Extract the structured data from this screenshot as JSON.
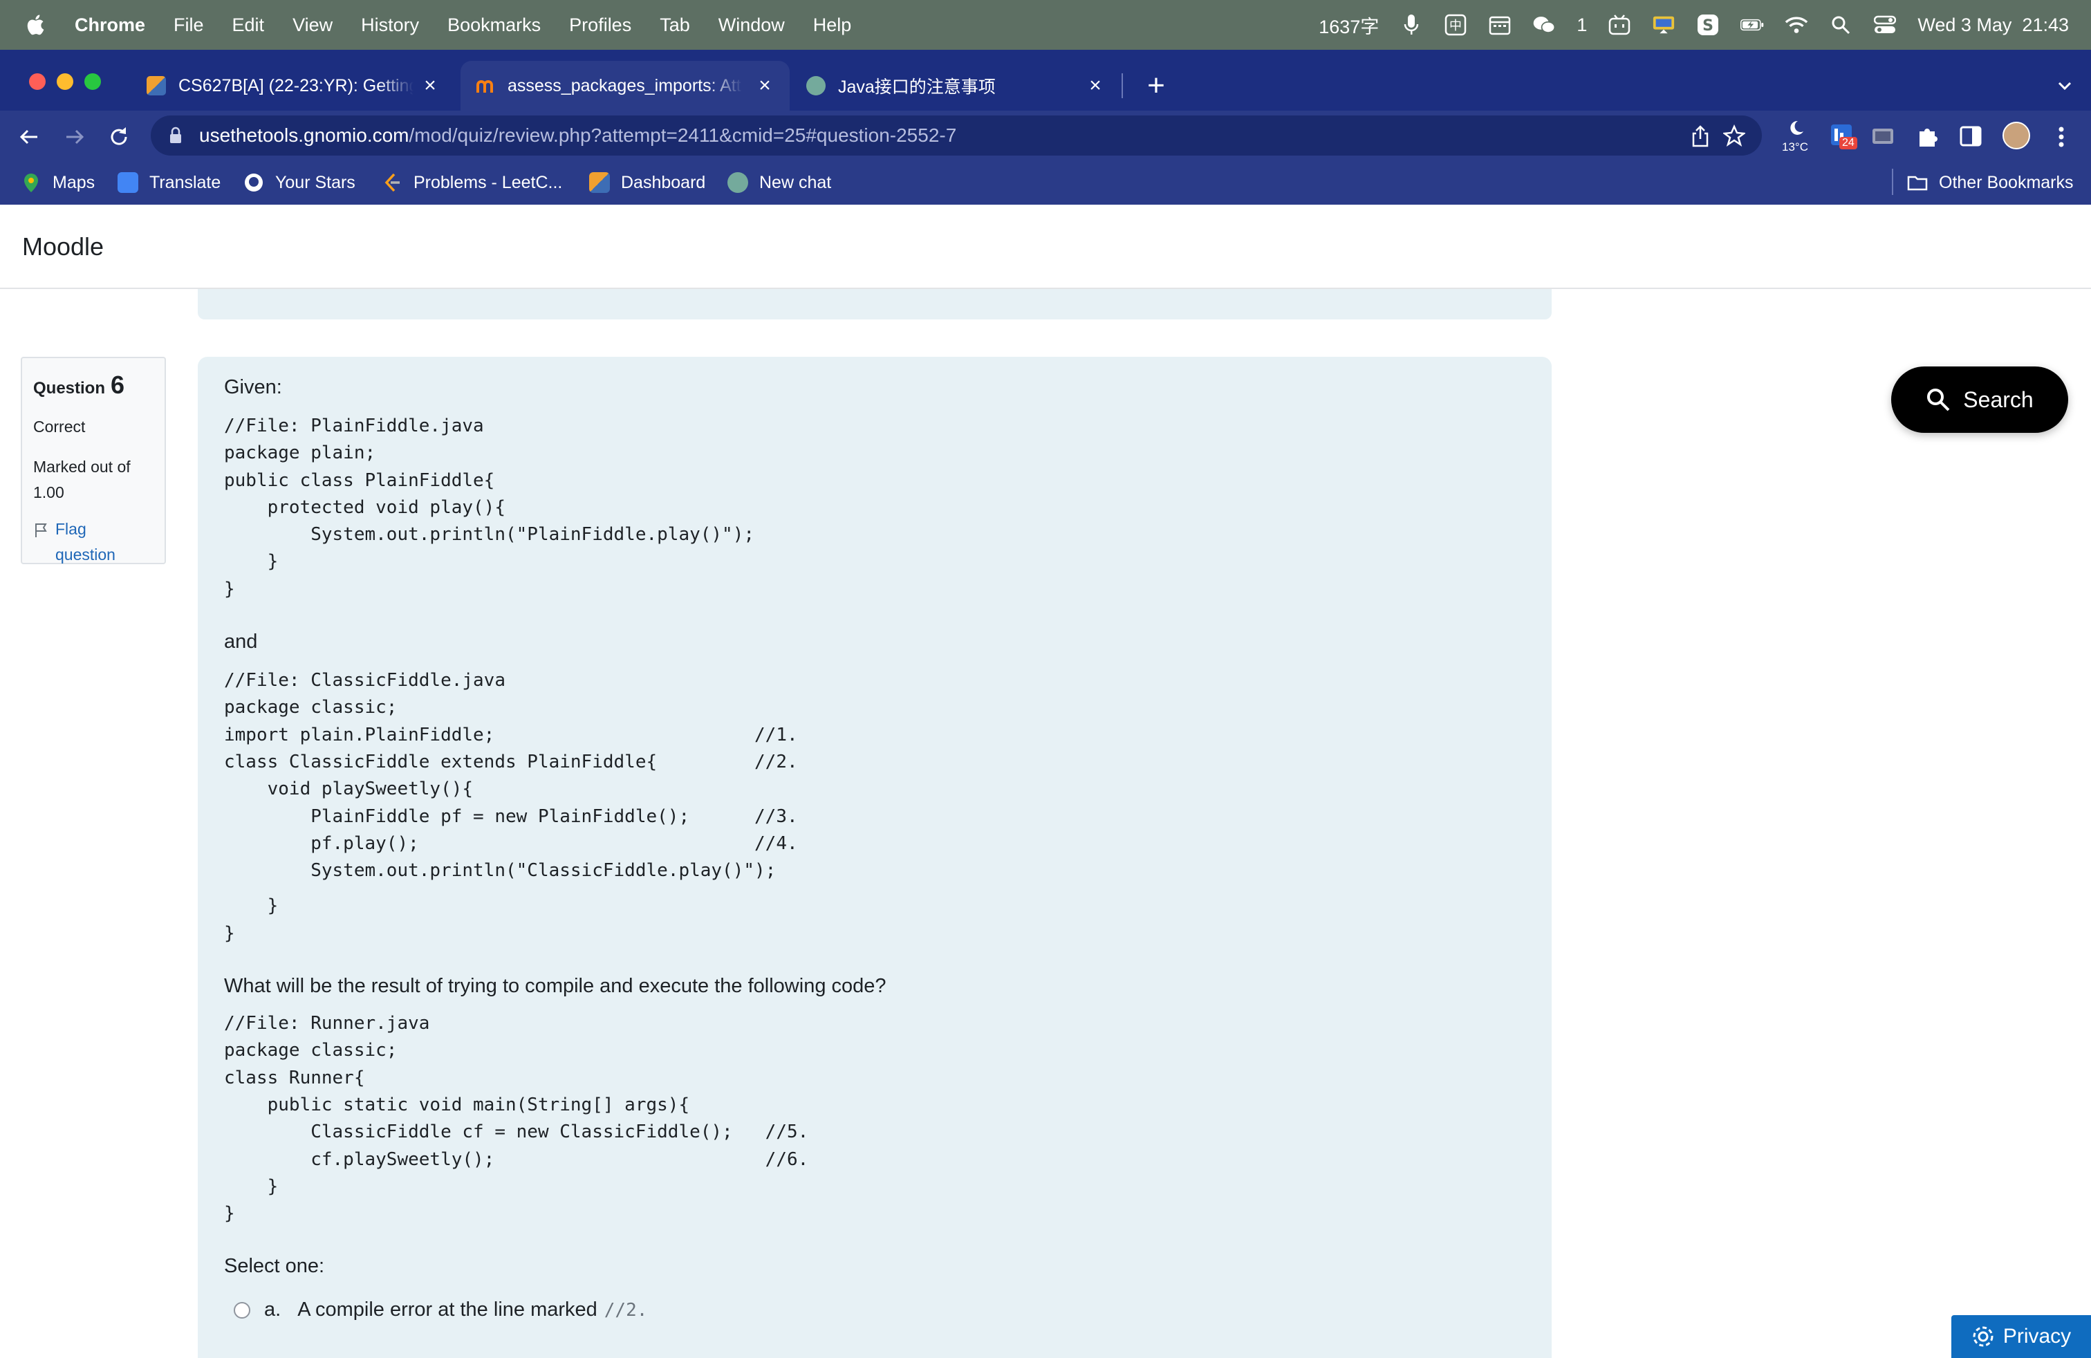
{
  "menubar": {
    "app": "Chrome",
    "items": [
      "File",
      "Edit",
      "View",
      "History",
      "Bookmarks",
      "Profiles",
      "Tab",
      "Window",
      "Help"
    ],
    "word_count": "1637字",
    "wechat_count": "1",
    "datetime": "Wed 3 May  21:43"
  },
  "tabs": [
    {
      "title": "CS627B[A] (22-23:YR): Getting",
      "favicon": "moodle-icon"
    },
    {
      "title": "assess_packages_imports: Att",
      "favicon": "moodle-m-icon"
    },
    {
      "title": "Java接口的注意事项",
      "favicon": "chatgpt-icon"
    }
  ],
  "omnibox": {
    "host": "usethetools.gnomio.com",
    "path": "/mod/quiz/review.php?attempt=2411&cmid=25#question-2552-7"
  },
  "toolbar": {
    "weather": "13°C",
    "badge_count": "24"
  },
  "bookmarks": {
    "items": [
      "Maps",
      "Translate",
      "Your Stars",
      "Problems - LeetC...",
      "Dashboard",
      "New chat"
    ],
    "other": "Other Bookmarks"
  },
  "page": {
    "brand": "Moodle",
    "question": {
      "label": "Question",
      "number": "6",
      "state": "Correct",
      "grade": "Marked out of 1.00",
      "flag": "Flag question"
    },
    "given_label": "Given:",
    "code1": "//File: PlainFiddle.java\npackage plain;\npublic class PlainFiddle{\n    protected void play(){\n        System.out.println(\"PlainFiddle.play()\");\n    }\n}",
    "and_label": "and",
    "code2": "//File: ClassicFiddle.java\npackage classic;\nimport plain.PlainFiddle;                        //1.\nclass ClassicFiddle extends PlainFiddle{         //2.\n    void playSweetly(){\n        PlainFiddle pf = new PlainFiddle();      //3.\n        pf.play();                               //4.\n        System.out.println(\"ClassicFiddle.play()\");",
    "code2_tail": "    }\n}",
    "prompt": "What will be the result of trying to compile and execute the following code?",
    "code3": "//File: Runner.java\npackage classic;\nclass Runner{\n    public static void main(String[] args){\n        ClassicFiddle cf = new ClassicFiddle();   //5.\n        cf.playSweetly();                         //6.\n    }\n}",
    "select_one": "Select one:",
    "option_a": {
      "letter": "a.",
      "text": "A compile error at the line marked",
      "code": "//2."
    }
  },
  "search_button": "Search",
  "privacy_button": "Privacy",
  "colors": {
    "tabstrip": "#1c2e80",
    "toolbar": "#2a3b88",
    "question_bg": "#e7f1f5",
    "link": "#1f67b7",
    "privacy": "#0f6cbf"
  }
}
